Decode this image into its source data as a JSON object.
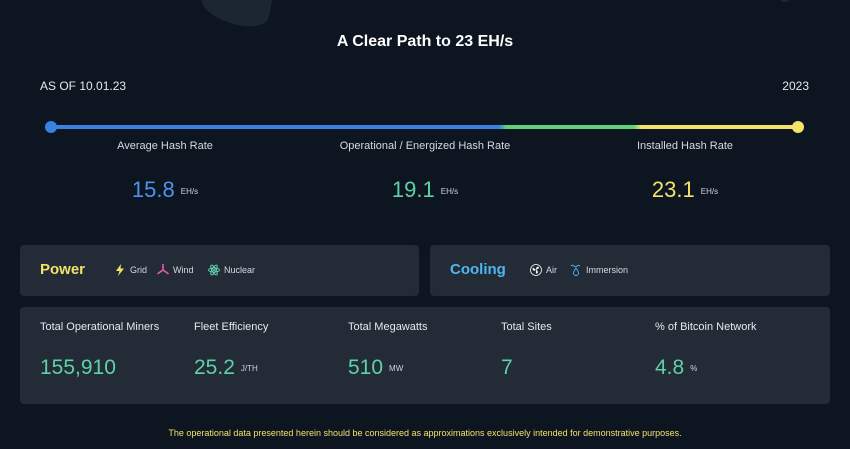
{
  "page": {
    "title": "A Clear Path to 23 EH/s",
    "as_of": "AS OF 10.01.23",
    "year": "2023",
    "disclaimer": "The operational data presented herein should be considered as approximations exclusively intended for demonstrative purposes."
  },
  "hash_metrics": [
    {
      "label": "Average Hash Rate",
      "value": "15.8",
      "unit": "EH/s",
      "color": "#4d93ee"
    },
    {
      "label": "Operational / Energized Hash Rate",
      "value": "19.1",
      "unit": "EH/s",
      "color": "#5fd1a8"
    },
    {
      "label": "Installed Hash Rate",
      "value": "23.1",
      "unit": "EH/s",
      "color": "#f2e36a"
    }
  ],
  "power": {
    "title": "Power",
    "items": [
      {
        "label": "Grid",
        "icon": "lightning-icon"
      },
      {
        "label": "Wind",
        "icon": "wind-turbine-icon"
      },
      {
        "label": "Nuclear",
        "icon": "atom-icon"
      }
    ]
  },
  "cooling": {
    "title": "Cooling",
    "items": [
      {
        "label": "Air",
        "icon": "fan-icon"
      },
      {
        "label": "Immersion",
        "icon": "water-drop-icon"
      }
    ]
  },
  "stats": [
    {
      "label": "Total Operational Miners",
      "value": "155,910",
      "unit": ""
    },
    {
      "label": "Fleet Efficiency",
      "value": "25.2",
      "unit": "J/TH"
    },
    {
      "label": "Total Megawatts",
      "value": "510",
      "unit": "MW"
    },
    {
      "label": "Total Sites",
      "value": "7",
      "unit": ""
    },
    {
      "label": "% of Bitcoin Network",
      "value": "4.8",
      "unit": "%"
    }
  ],
  "colors": {
    "background": "#0d1520",
    "panel": "#232b37",
    "blue": "#3b82e0",
    "green": "#5fd17a",
    "yellow": "#f2e36a"
  }
}
